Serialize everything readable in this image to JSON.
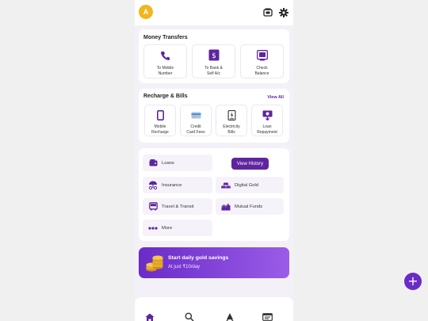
{
  "header": {
    "avatar_initial": "A",
    "icons": [
      "wallet-icon",
      "settings-gear-icon"
    ]
  },
  "money_transfers": {
    "title": "Money Transfers",
    "tiles": [
      {
        "label_line1": "To Mobile",
        "label_line2": "Number",
        "icon": "phone-icon"
      },
      {
        "label_line1": "To Bank &",
        "label_line2": "Self A/c",
        "icon": "bank-dollar-icon"
      },
      {
        "label_line1": "Check",
        "label_line2": "Balance",
        "icon": "check-balance-icon"
      }
    ]
  },
  "recharge_bills": {
    "title": "Recharge & Bills",
    "view_all": "View All",
    "tiles": [
      {
        "label_line1": "Mobile",
        "label_line2": "Recharge",
        "icon": "mobile-icon"
      },
      {
        "label_line1": "Credit",
        "label_line2": "Card Fees",
        "icon": "credit-card-icon"
      },
      {
        "label_line1": "Electricity",
        "label_line2": "Bills",
        "icon": "electricity-bill-icon"
      },
      {
        "label_line1": "Loan",
        "label_line2": "Repayment",
        "icon": "loan-repayment-icon"
      }
    ]
  },
  "services": {
    "view_history": "View History",
    "items": [
      {
        "label": "Loans",
        "icon": "wallet-icon"
      },
      {
        "label": "Insurance",
        "icon": "insurance-umbrella-icon"
      },
      {
        "label": "Digital Gold",
        "icon": "gold-bars-icon"
      },
      {
        "label": "Travel & Transit",
        "icon": "bus-icon"
      },
      {
        "label": "Mutual Funds",
        "icon": "chart-icon"
      },
      {
        "label": "More",
        "icon": "more-dots-icon"
      }
    ]
  },
  "banner": {
    "title": "Start daily gold savings",
    "subtitle": "At just ₹10/day",
    "icon": "gold-coins-icon"
  },
  "bottom_nav": {
    "icons": [
      "home-icon",
      "search-icon",
      "alerts-icon",
      "history-icon"
    ]
  },
  "fab": {
    "label": "+"
  },
  "colors": {
    "brand": "#5f259f",
    "accent_gradient_start": "#6a2bc8",
    "accent_gradient_end": "#9a5ce8",
    "avatar": "#f2b51d",
    "background": "#f3f1f7"
  }
}
